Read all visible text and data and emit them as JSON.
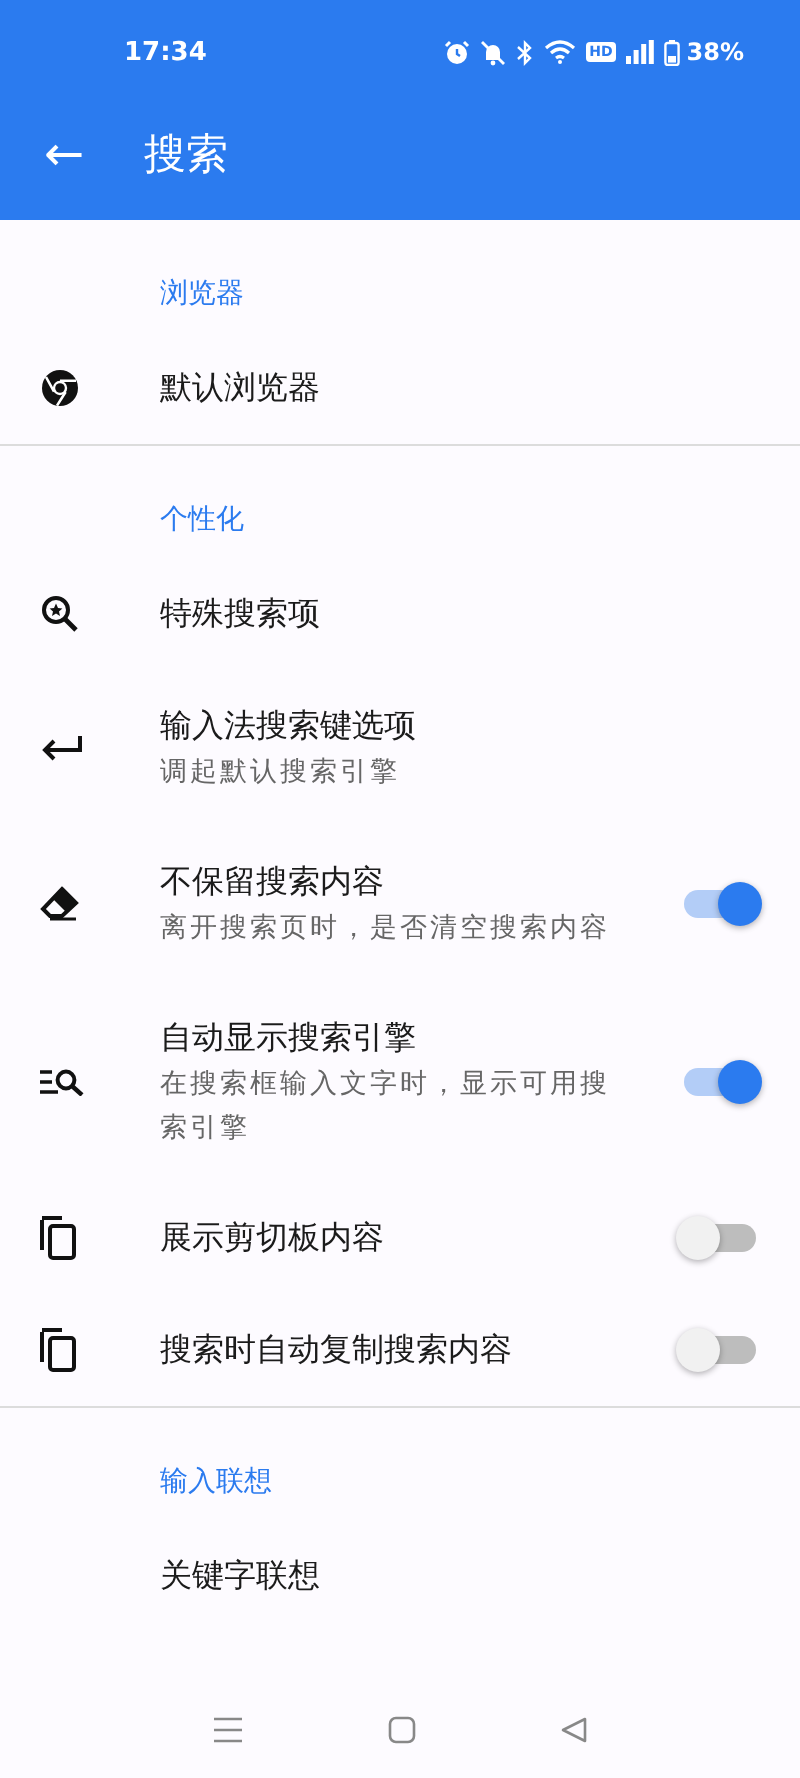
{
  "status_bar": {
    "time": "17:34",
    "hd": "HD",
    "battery": "38%"
  },
  "app_bar": {
    "back": "←",
    "title": "搜索"
  },
  "rows": [
    {
      "kind": "header",
      "title": "浏览器"
    },
    {
      "kind": "item",
      "title": "默认浏览器"
    },
    {
      "kind": "header",
      "title": "个性化"
    },
    {
      "kind": "item",
      "title": "特殊搜索项"
    },
    {
      "kind": "item",
      "title": "输入法搜索键选项",
      "subtitle": "调起默认搜索引擎"
    },
    {
      "kind": "toggle",
      "title": "不保留搜索内容",
      "subtitle": "离开搜索页时，是否清空搜索内容",
      "on": true
    },
    {
      "kind": "toggle",
      "title": "自动显示搜索引擎",
      "subtitle": "在搜索框输入文字时，显示可用搜索引擎",
      "on": true
    },
    {
      "kind": "toggle",
      "title": "展示剪切板内容",
      "on": false
    },
    {
      "kind": "toggle",
      "title": "搜索时自动复制搜索内容",
      "on": false
    },
    {
      "kind": "header",
      "title": "输入联想"
    },
    {
      "kind": "item",
      "title": "关键字联想"
    }
  ]
}
